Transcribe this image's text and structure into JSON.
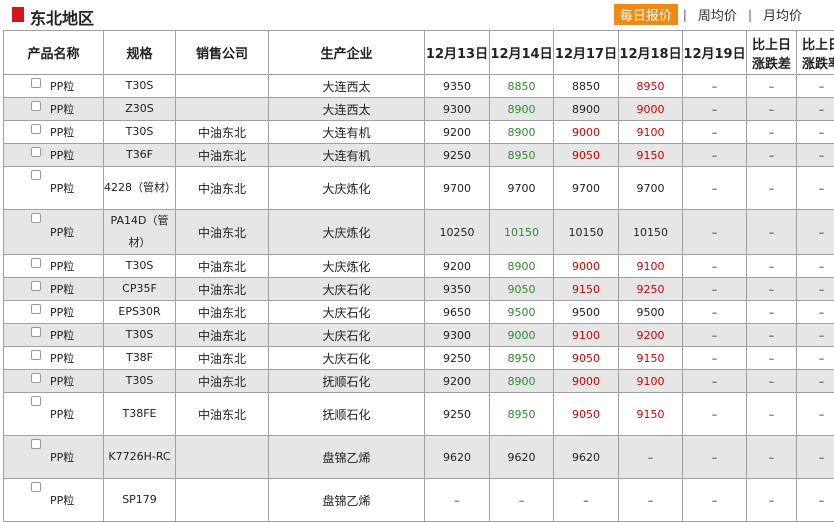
{
  "header": {
    "title": "东北地区",
    "tabs": [
      {
        "label": "每日报价",
        "active": true
      },
      {
        "label": "周均价",
        "active": false
      },
      {
        "label": "月均价",
        "active": false
      }
    ],
    "separator": "|"
  },
  "table": {
    "columns": [
      "产品名称",
      "规格",
      "销售公司",
      "生产企业",
      "12月13日",
      "12月14日",
      "12月17日",
      "12月18日",
      "12月19日",
      "比上日涨跌差",
      "比上日涨跌率"
    ],
    "colors": {
      "up": "#d10000",
      "down": "#2e8b2e",
      "accent": "#f08a16",
      "marker": "#d7121a"
    },
    "rows": [
      {
        "name": "PP粒",
        "spec": "T30S",
        "company": "",
        "factory": "大连西太",
        "p1": "9350",
        "p2": "8850",
        "p2c": "green",
        "p3": "8850",
        "p3c": "",
        "p4": "8950",
        "p4c": "red",
        "p5": "–",
        "diff": "–",
        "rate": "–"
      },
      {
        "name": "PP粒",
        "spec": "Z30S",
        "company": "",
        "factory": "大连西太",
        "p1": "9300",
        "p2": "8900",
        "p2c": "green",
        "p3": "8900",
        "p3c": "",
        "p4": "9000",
        "p4c": "red",
        "p5": "–",
        "diff": "–",
        "rate": "–"
      },
      {
        "name": "PP粒",
        "spec": "T30S",
        "company": "中油东北",
        "factory": "大连有机",
        "p1": "9200",
        "p2": "8900",
        "p2c": "green",
        "p3": "9000",
        "p3c": "red",
        "p4": "9100",
        "p4c": "red",
        "p5": "–",
        "diff": "–",
        "rate": "–"
      },
      {
        "name": "PP粒",
        "spec": "T36F",
        "company": "中油东北",
        "factory": "大连有机",
        "p1": "9250",
        "p2": "8950",
        "p2c": "green",
        "p3": "9050",
        "p3c": "red",
        "p4": "9150",
        "p4c": "red",
        "p5": "–",
        "diff": "–",
        "rate": "–"
      },
      {
        "name": "PP粒",
        "spec": "4228（管材）",
        "company": "中油东北",
        "factory": "大庆炼化",
        "p1": "9700",
        "p2": "9700",
        "p2c": "",
        "p3": "9700",
        "p3c": "",
        "p4": "9700",
        "p4c": "",
        "p5": "–",
        "diff": "–",
        "rate": "–"
      },
      {
        "name": "PP粒",
        "spec": "PA14D（管材）",
        "company": "中油东北",
        "factory": "大庆炼化",
        "p1": "10250",
        "p2": "10150",
        "p2c": "green",
        "p3": "10150",
        "p3c": "",
        "p4": "10150",
        "p4c": "",
        "p5": "–",
        "diff": "–",
        "rate": "–"
      },
      {
        "name": "PP粒",
        "spec": "T30S",
        "company": "中油东北",
        "factory": "大庆炼化",
        "p1": "9200",
        "p2": "8900",
        "p2c": "green",
        "p3": "9000",
        "p3c": "red",
        "p4": "9100",
        "p4c": "red",
        "p5": "–",
        "diff": "–",
        "rate": "–"
      },
      {
        "name": "PP粒",
        "spec": "CP35F",
        "company": "中油东北",
        "factory": "大庆石化",
        "p1": "9350",
        "p2": "9050",
        "p2c": "green",
        "p3": "9150",
        "p3c": "red",
        "p4": "9250",
        "p4c": "red",
        "p5": "–",
        "diff": "–",
        "rate": "–"
      },
      {
        "name": "PP粒",
        "spec": "EPS30R",
        "company": "中油东北",
        "factory": "大庆石化",
        "p1": "9650",
        "p2": "9500",
        "p2c": "green",
        "p3": "9500",
        "p3c": "",
        "p4": "9500",
        "p4c": "",
        "p5": "–",
        "diff": "–",
        "rate": "–"
      },
      {
        "name": "PP粒",
        "spec": "T30S",
        "company": "中油东北",
        "factory": "大庆石化",
        "p1": "9300",
        "p2": "9000",
        "p2c": "green",
        "p3": "9100",
        "p3c": "red",
        "p4": "9200",
        "p4c": "red",
        "p5": "–",
        "diff": "–",
        "rate": "–"
      },
      {
        "name": "PP粒",
        "spec": "T38F",
        "company": "中油东北",
        "factory": "大庆石化",
        "p1": "9250",
        "p2": "8950",
        "p2c": "green",
        "p3": "9050",
        "p3c": "red",
        "p4": "9150",
        "p4c": "red",
        "p5": "–",
        "diff": "–",
        "rate": "–"
      },
      {
        "name": "PP粒",
        "spec": "T30S",
        "company": "中油东北",
        "factory": "抚顺石化",
        "p1": "9200",
        "p2": "8900",
        "p2c": "green",
        "p3": "9000",
        "p3c": "red",
        "p4": "9100",
        "p4c": "red",
        "p5": "–",
        "diff": "–",
        "rate": "–"
      },
      {
        "name": "PP粒",
        "spec": "T38FE",
        "company": "中油东北",
        "factory": "抚顺石化",
        "p1": "9250",
        "p2": "8950",
        "p2c": "green",
        "p3": "9050",
        "p3c": "red",
        "p4": "9150",
        "p4c": "red",
        "p5": "–",
        "diff": "–",
        "rate": "–"
      },
      {
        "name": "PP粒",
        "spec": "K7726H-RC",
        "company": "",
        "factory": "盘锦乙烯",
        "p1": "9620",
        "p2": "9620",
        "p2c": "",
        "p3": "9620",
        "p3c": "",
        "p4": "–",
        "p4c": "",
        "p5": "–",
        "diff": "–",
        "rate": "–"
      },
      {
        "name": "PP粒",
        "spec": "SP179",
        "company": "",
        "factory": "盘锦乙烯",
        "p1": "–",
        "p2": "–",
        "p2c": "",
        "p3": "–",
        "p3c": "",
        "p4": "–",
        "p4c": "",
        "p5": "–",
        "diff": "–",
        "rate": "–"
      }
    ]
  }
}
